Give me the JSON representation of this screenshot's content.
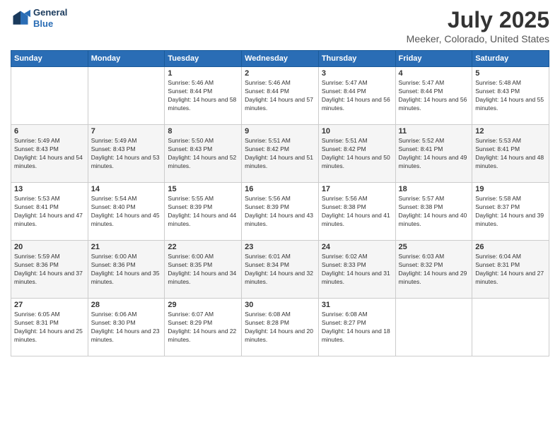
{
  "logo": {
    "line1": "General",
    "line2": "Blue"
  },
  "title": "July 2025",
  "subtitle": "Meeker, Colorado, United States",
  "days_of_week": [
    "Sunday",
    "Monday",
    "Tuesday",
    "Wednesday",
    "Thursday",
    "Friday",
    "Saturday"
  ],
  "weeks": [
    [
      {
        "day": "",
        "info": ""
      },
      {
        "day": "",
        "info": ""
      },
      {
        "day": "1",
        "info": "Sunrise: 5:46 AM\nSunset: 8:44 PM\nDaylight: 14 hours and 58 minutes."
      },
      {
        "day": "2",
        "info": "Sunrise: 5:46 AM\nSunset: 8:44 PM\nDaylight: 14 hours and 57 minutes."
      },
      {
        "day": "3",
        "info": "Sunrise: 5:47 AM\nSunset: 8:44 PM\nDaylight: 14 hours and 56 minutes."
      },
      {
        "day": "4",
        "info": "Sunrise: 5:47 AM\nSunset: 8:44 PM\nDaylight: 14 hours and 56 minutes."
      },
      {
        "day": "5",
        "info": "Sunrise: 5:48 AM\nSunset: 8:43 PM\nDaylight: 14 hours and 55 minutes."
      }
    ],
    [
      {
        "day": "6",
        "info": "Sunrise: 5:49 AM\nSunset: 8:43 PM\nDaylight: 14 hours and 54 minutes."
      },
      {
        "day": "7",
        "info": "Sunrise: 5:49 AM\nSunset: 8:43 PM\nDaylight: 14 hours and 53 minutes."
      },
      {
        "day": "8",
        "info": "Sunrise: 5:50 AM\nSunset: 8:43 PM\nDaylight: 14 hours and 52 minutes."
      },
      {
        "day": "9",
        "info": "Sunrise: 5:51 AM\nSunset: 8:42 PM\nDaylight: 14 hours and 51 minutes."
      },
      {
        "day": "10",
        "info": "Sunrise: 5:51 AM\nSunset: 8:42 PM\nDaylight: 14 hours and 50 minutes."
      },
      {
        "day": "11",
        "info": "Sunrise: 5:52 AM\nSunset: 8:41 PM\nDaylight: 14 hours and 49 minutes."
      },
      {
        "day": "12",
        "info": "Sunrise: 5:53 AM\nSunset: 8:41 PM\nDaylight: 14 hours and 48 minutes."
      }
    ],
    [
      {
        "day": "13",
        "info": "Sunrise: 5:53 AM\nSunset: 8:41 PM\nDaylight: 14 hours and 47 minutes."
      },
      {
        "day": "14",
        "info": "Sunrise: 5:54 AM\nSunset: 8:40 PM\nDaylight: 14 hours and 45 minutes."
      },
      {
        "day": "15",
        "info": "Sunrise: 5:55 AM\nSunset: 8:39 PM\nDaylight: 14 hours and 44 minutes."
      },
      {
        "day": "16",
        "info": "Sunrise: 5:56 AM\nSunset: 8:39 PM\nDaylight: 14 hours and 43 minutes."
      },
      {
        "day": "17",
        "info": "Sunrise: 5:56 AM\nSunset: 8:38 PM\nDaylight: 14 hours and 41 minutes."
      },
      {
        "day": "18",
        "info": "Sunrise: 5:57 AM\nSunset: 8:38 PM\nDaylight: 14 hours and 40 minutes."
      },
      {
        "day": "19",
        "info": "Sunrise: 5:58 AM\nSunset: 8:37 PM\nDaylight: 14 hours and 39 minutes."
      }
    ],
    [
      {
        "day": "20",
        "info": "Sunrise: 5:59 AM\nSunset: 8:36 PM\nDaylight: 14 hours and 37 minutes."
      },
      {
        "day": "21",
        "info": "Sunrise: 6:00 AM\nSunset: 8:36 PM\nDaylight: 14 hours and 35 minutes."
      },
      {
        "day": "22",
        "info": "Sunrise: 6:00 AM\nSunset: 8:35 PM\nDaylight: 14 hours and 34 minutes."
      },
      {
        "day": "23",
        "info": "Sunrise: 6:01 AM\nSunset: 8:34 PM\nDaylight: 14 hours and 32 minutes."
      },
      {
        "day": "24",
        "info": "Sunrise: 6:02 AM\nSunset: 8:33 PM\nDaylight: 14 hours and 31 minutes."
      },
      {
        "day": "25",
        "info": "Sunrise: 6:03 AM\nSunset: 8:32 PM\nDaylight: 14 hours and 29 minutes."
      },
      {
        "day": "26",
        "info": "Sunrise: 6:04 AM\nSunset: 8:31 PM\nDaylight: 14 hours and 27 minutes."
      }
    ],
    [
      {
        "day": "27",
        "info": "Sunrise: 6:05 AM\nSunset: 8:31 PM\nDaylight: 14 hours and 25 minutes."
      },
      {
        "day": "28",
        "info": "Sunrise: 6:06 AM\nSunset: 8:30 PM\nDaylight: 14 hours and 23 minutes."
      },
      {
        "day": "29",
        "info": "Sunrise: 6:07 AM\nSunset: 8:29 PM\nDaylight: 14 hours and 22 minutes."
      },
      {
        "day": "30",
        "info": "Sunrise: 6:08 AM\nSunset: 8:28 PM\nDaylight: 14 hours and 20 minutes."
      },
      {
        "day": "31",
        "info": "Sunrise: 6:08 AM\nSunset: 8:27 PM\nDaylight: 14 hours and 18 minutes."
      },
      {
        "day": "",
        "info": ""
      },
      {
        "day": "",
        "info": ""
      }
    ]
  ]
}
